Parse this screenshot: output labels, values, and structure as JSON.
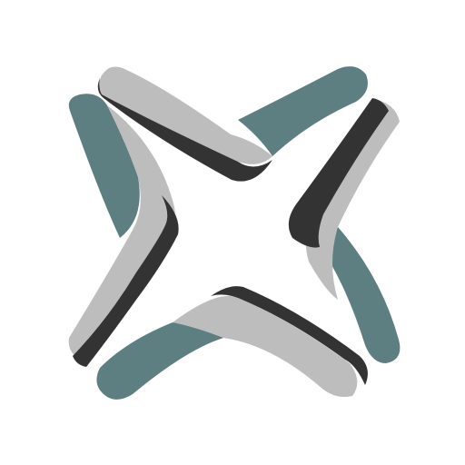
{
  "logo": {
    "icon": "four-pointed-star-logo-icon",
    "colors": {
      "teal": "#5D7F81",
      "light_gray": "#BDBDBD",
      "dark_gray": "#333333",
      "background": "#FFFFFF"
    }
  }
}
